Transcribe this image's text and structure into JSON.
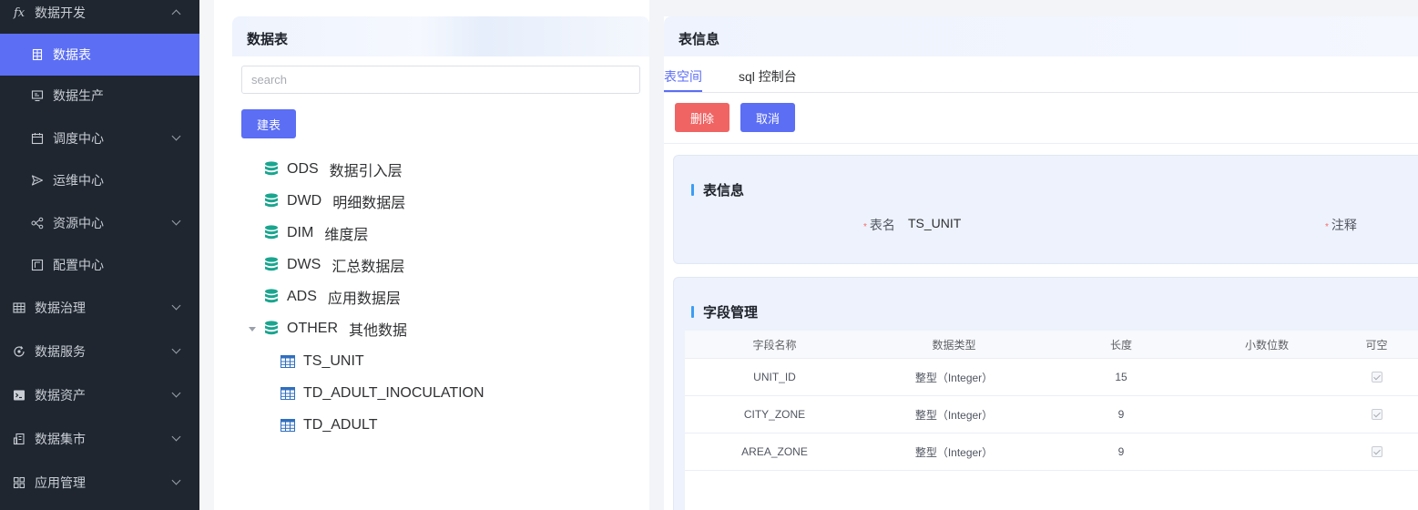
{
  "sidebar": {
    "items": [
      {
        "label": "数据开发",
        "icon": "function-icon",
        "level": "top",
        "chevron": "up"
      },
      {
        "label": "数据表",
        "icon": "table-grid-icon",
        "level": "sub",
        "active": true
      },
      {
        "label": "数据生产",
        "icon": "monitor-icon",
        "level": "sub"
      },
      {
        "label": "调度中心",
        "icon": "calendar-icon",
        "level": "sub",
        "chevron": "down"
      },
      {
        "label": "运维中心",
        "icon": "send-icon",
        "level": "sub"
      },
      {
        "label": "资源中心",
        "icon": "share-nodes-icon",
        "level": "sub",
        "chevron": "down"
      },
      {
        "label": "配置中心",
        "icon": "config-board-icon",
        "level": "sub"
      },
      {
        "label": "数据治理",
        "icon": "grid-table-icon",
        "level": "top",
        "chevron": "down"
      },
      {
        "label": "数据服务",
        "icon": "refresh-gear-icon",
        "level": "top",
        "chevron": "down"
      },
      {
        "label": "数据资产",
        "icon": "terminal-icon",
        "level": "top",
        "chevron": "down"
      },
      {
        "label": "数据集市",
        "icon": "building-icon",
        "level": "top",
        "chevron": "down"
      },
      {
        "label": "应用管理",
        "icon": "apps-grid-icon",
        "level": "top",
        "chevron": "down"
      }
    ]
  },
  "left_panel": {
    "title": "数据表",
    "search_placeholder": "search",
    "create_button": "建表",
    "tree": [
      {
        "code": "ODS",
        "name": "数据引入层",
        "type": "database"
      },
      {
        "code": "DWD",
        "name": "明细数据层",
        "type": "database"
      },
      {
        "code": "DIM",
        "name": "维度层",
        "type": "database"
      },
      {
        "code": "DWS",
        "name": "汇总数据层",
        "type": "database"
      },
      {
        "code": "ADS",
        "name": "应用数据层",
        "type": "database"
      },
      {
        "code": "OTHER",
        "name": "其他数据",
        "type": "database",
        "expanded": true
      },
      {
        "code": "TS_UNIT",
        "name": "",
        "type": "table"
      },
      {
        "code": "TD_ADULT_INOCULATION",
        "name": "",
        "type": "table"
      },
      {
        "code": "TD_ADULT",
        "name": "",
        "type": "table"
      }
    ]
  },
  "right_panel": {
    "title": "表信息",
    "tabs": [
      {
        "label": "表空间",
        "active": true
      },
      {
        "label": "sql 控制台",
        "active": false
      }
    ],
    "delete_button": "删除",
    "cancel_button": "取消",
    "info_card": {
      "title": "表信息",
      "required_mark": "*",
      "table_name_label": "表名",
      "table_name_value": "TS_UNIT",
      "comment_label": "注释"
    },
    "fields_card": {
      "title": "字段管理",
      "columns": [
        "字段名称",
        "数据类型",
        "长度",
        "小数位数",
        "可空"
      ],
      "rows": [
        {
          "name": "UNIT_ID",
          "type": "整型（Integer）",
          "length": "15",
          "scale": "",
          "nullable": true
        },
        {
          "name": "CITY_ZONE",
          "type": "整型（Integer）",
          "length": "9",
          "scale": "",
          "nullable": true
        },
        {
          "name": "AREA_ZONE",
          "type": "整型（Integer）",
          "length": "9",
          "scale": "",
          "nullable": true
        }
      ]
    }
  },
  "colors": {
    "sidebar_bg": "#1f2630",
    "accent": "#5b6ef4",
    "danger": "#f06464",
    "db_icon": "#1aa58f",
    "table_icon": "#2f6fbf"
  }
}
